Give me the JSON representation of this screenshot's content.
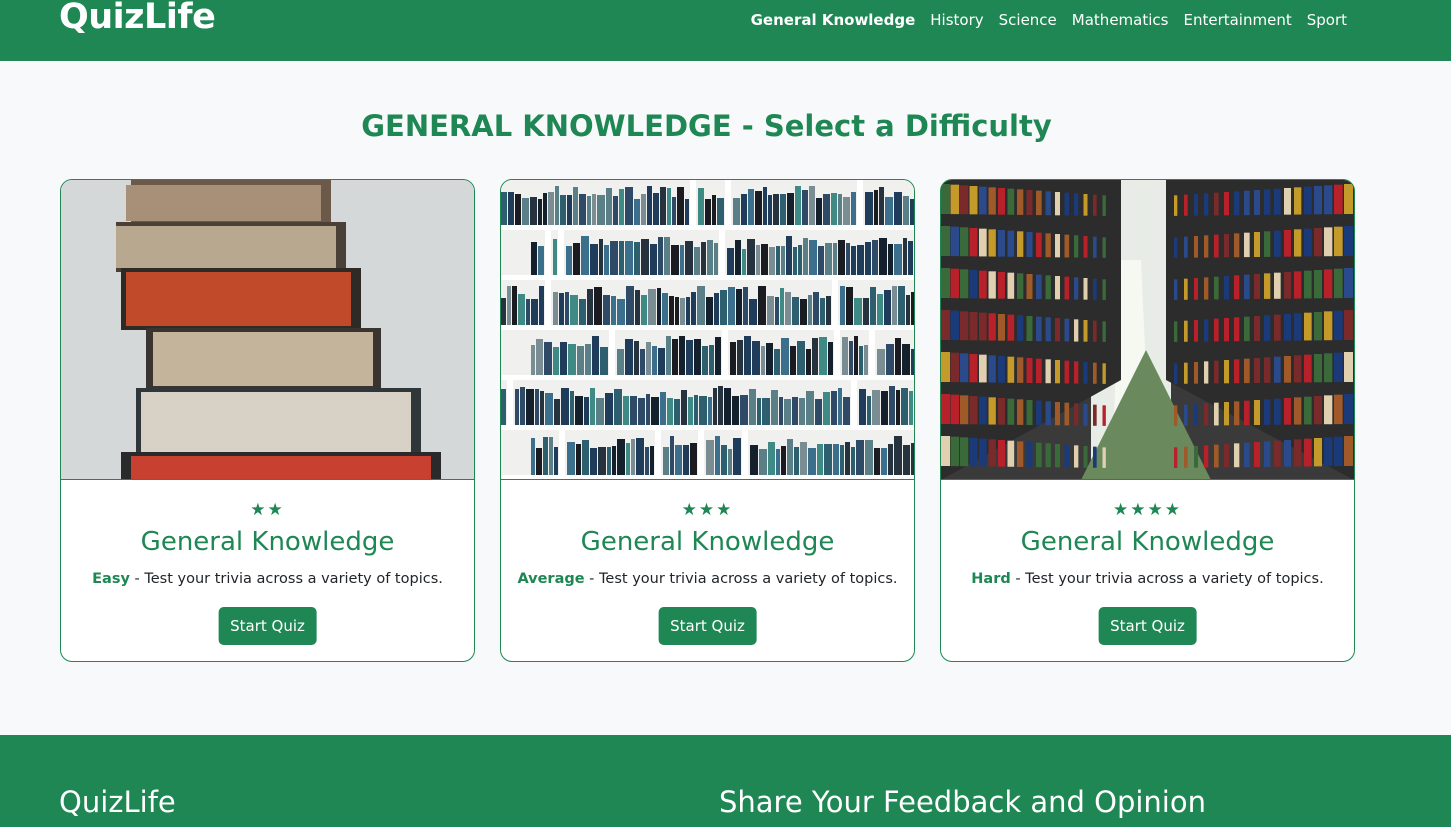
{
  "navbar": {
    "brand": "QuizLife",
    "links": [
      "General Knowledge",
      "History",
      "Science",
      "Mathematics",
      "Entertainment",
      "Sport"
    ],
    "active_index": 0
  },
  "main": {
    "heading": "GENERAL KNOWLEDGE - Select a Difficulty",
    "cards": [
      {
        "image": "stacked-books-photo",
        "stars": "★★",
        "title": "General Knowledge",
        "level": "Easy",
        "description": " - Test your trivia across a variety of topics.",
        "button": "Start Quiz"
      },
      {
        "image": "bookshelf-wall-photo",
        "stars": "★★★",
        "title": "General Knowledge",
        "level": "Average",
        "description": " - Test your trivia across a variety of topics.",
        "button": "Start Quiz"
      },
      {
        "image": "library-aisle-photo",
        "stars": "★★★★",
        "title": "General Knowledge",
        "level": "Hard",
        "description": " - Test your trivia across a variety of topics.",
        "button": "Start Quiz"
      }
    ]
  },
  "footer": {
    "brand": "QuizLife",
    "feedback_heading": "Share Your Feedback and Opinion"
  },
  "colors": {
    "primary": "#1e8754",
    "background": "#f8f9fa",
    "card": "#ffffff"
  }
}
